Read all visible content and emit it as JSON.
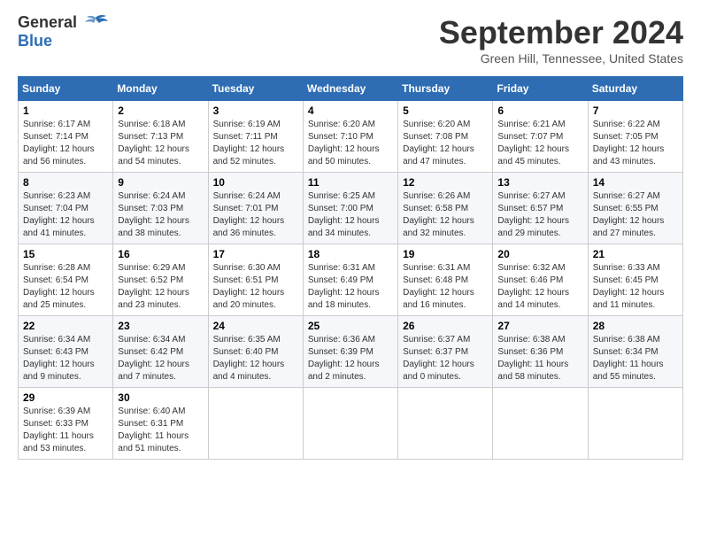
{
  "header": {
    "logo_line1": "General",
    "logo_line2": "Blue",
    "month_title": "September 2024",
    "location": "Green Hill, Tennessee, United States"
  },
  "weekdays": [
    "Sunday",
    "Monday",
    "Tuesday",
    "Wednesday",
    "Thursday",
    "Friday",
    "Saturday"
  ],
  "weeks": [
    [
      {
        "day": "1",
        "sunrise": "6:17 AM",
        "sunset": "7:14 PM",
        "daylight": "12 hours and 56 minutes."
      },
      {
        "day": "2",
        "sunrise": "6:18 AM",
        "sunset": "7:13 PM",
        "daylight": "12 hours and 54 minutes."
      },
      {
        "day": "3",
        "sunrise": "6:19 AM",
        "sunset": "7:11 PM",
        "daylight": "12 hours and 52 minutes."
      },
      {
        "day": "4",
        "sunrise": "6:20 AM",
        "sunset": "7:10 PM",
        "daylight": "12 hours and 50 minutes."
      },
      {
        "day": "5",
        "sunrise": "6:20 AM",
        "sunset": "7:08 PM",
        "daylight": "12 hours and 47 minutes."
      },
      {
        "day": "6",
        "sunrise": "6:21 AM",
        "sunset": "7:07 PM",
        "daylight": "12 hours and 45 minutes."
      },
      {
        "day": "7",
        "sunrise": "6:22 AM",
        "sunset": "7:05 PM",
        "daylight": "12 hours and 43 minutes."
      }
    ],
    [
      {
        "day": "8",
        "sunrise": "6:23 AM",
        "sunset": "7:04 PM",
        "daylight": "12 hours and 41 minutes."
      },
      {
        "day": "9",
        "sunrise": "6:24 AM",
        "sunset": "7:03 PM",
        "daylight": "12 hours and 38 minutes."
      },
      {
        "day": "10",
        "sunrise": "6:24 AM",
        "sunset": "7:01 PM",
        "daylight": "12 hours and 36 minutes."
      },
      {
        "day": "11",
        "sunrise": "6:25 AM",
        "sunset": "7:00 PM",
        "daylight": "12 hours and 34 minutes."
      },
      {
        "day": "12",
        "sunrise": "6:26 AM",
        "sunset": "6:58 PM",
        "daylight": "12 hours and 32 minutes."
      },
      {
        "day": "13",
        "sunrise": "6:27 AM",
        "sunset": "6:57 PM",
        "daylight": "12 hours and 29 minutes."
      },
      {
        "day": "14",
        "sunrise": "6:27 AM",
        "sunset": "6:55 PM",
        "daylight": "12 hours and 27 minutes."
      }
    ],
    [
      {
        "day": "15",
        "sunrise": "6:28 AM",
        "sunset": "6:54 PM",
        "daylight": "12 hours and 25 minutes."
      },
      {
        "day": "16",
        "sunrise": "6:29 AM",
        "sunset": "6:52 PM",
        "daylight": "12 hours and 23 minutes."
      },
      {
        "day": "17",
        "sunrise": "6:30 AM",
        "sunset": "6:51 PM",
        "daylight": "12 hours and 20 minutes."
      },
      {
        "day": "18",
        "sunrise": "6:31 AM",
        "sunset": "6:49 PM",
        "daylight": "12 hours and 18 minutes."
      },
      {
        "day": "19",
        "sunrise": "6:31 AM",
        "sunset": "6:48 PM",
        "daylight": "12 hours and 16 minutes."
      },
      {
        "day": "20",
        "sunrise": "6:32 AM",
        "sunset": "6:46 PM",
        "daylight": "12 hours and 14 minutes."
      },
      {
        "day": "21",
        "sunrise": "6:33 AM",
        "sunset": "6:45 PM",
        "daylight": "12 hours and 11 minutes."
      }
    ],
    [
      {
        "day": "22",
        "sunrise": "6:34 AM",
        "sunset": "6:43 PM",
        "daylight": "12 hours and 9 minutes."
      },
      {
        "day": "23",
        "sunrise": "6:34 AM",
        "sunset": "6:42 PM",
        "daylight": "12 hours and 7 minutes."
      },
      {
        "day": "24",
        "sunrise": "6:35 AM",
        "sunset": "6:40 PM",
        "daylight": "12 hours and 4 minutes."
      },
      {
        "day": "25",
        "sunrise": "6:36 AM",
        "sunset": "6:39 PM",
        "daylight": "12 hours and 2 minutes."
      },
      {
        "day": "26",
        "sunrise": "6:37 AM",
        "sunset": "6:37 PM",
        "daylight": "12 hours and 0 minutes."
      },
      {
        "day": "27",
        "sunrise": "6:38 AM",
        "sunset": "6:36 PM",
        "daylight": "11 hours and 58 minutes."
      },
      {
        "day": "28",
        "sunrise": "6:38 AM",
        "sunset": "6:34 PM",
        "daylight": "11 hours and 55 minutes."
      }
    ],
    [
      {
        "day": "29",
        "sunrise": "6:39 AM",
        "sunset": "6:33 PM",
        "daylight": "11 hours and 53 minutes."
      },
      {
        "day": "30",
        "sunrise": "6:40 AM",
        "sunset": "6:31 PM",
        "daylight": "11 hours and 51 minutes."
      },
      null,
      null,
      null,
      null,
      null
    ]
  ]
}
